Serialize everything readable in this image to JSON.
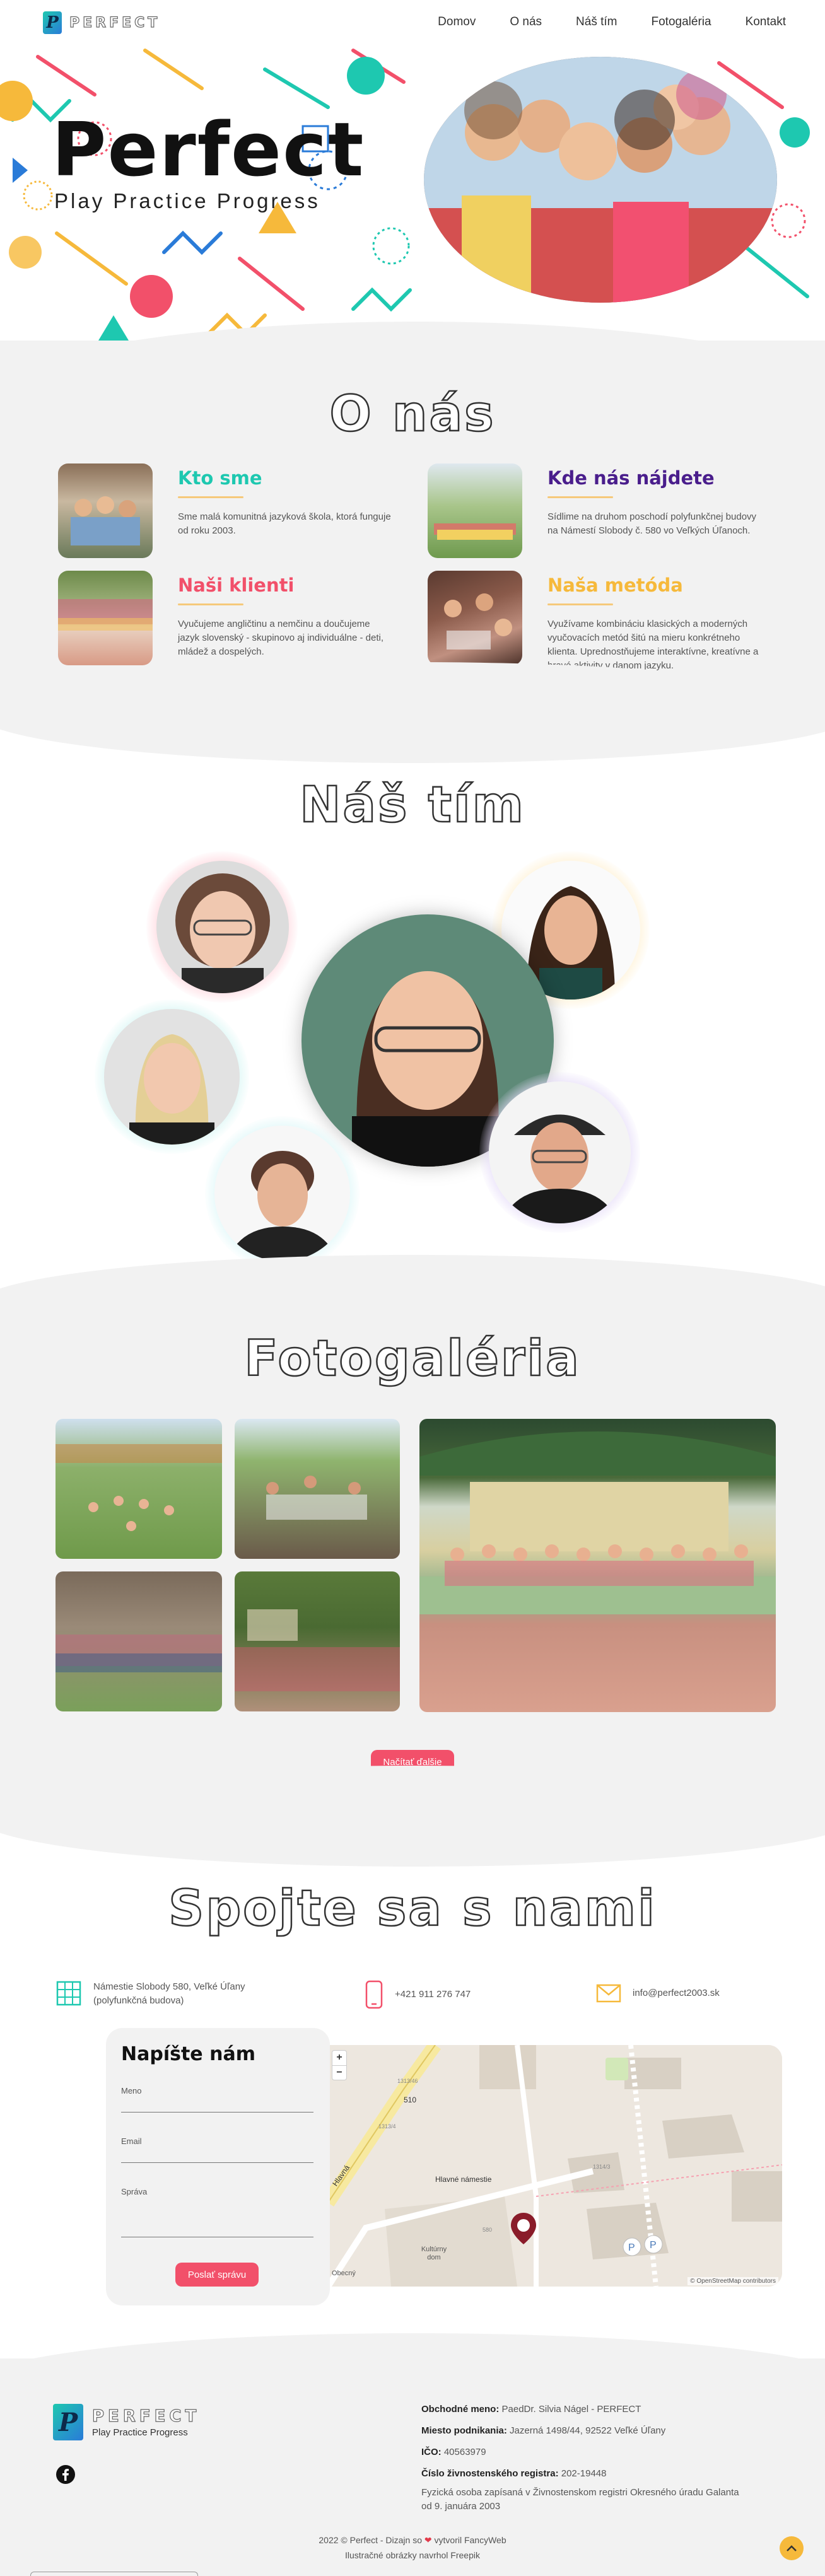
{
  "header": {
    "logo_letter": "P",
    "logo_text": "PERFECT",
    "nav": [
      "Domov",
      "O nás",
      "Náš tím",
      "Fotogaléria",
      "Kontakt"
    ]
  },
  "hero": {
    "title": "Perfect",
    "subtitle": "Play Practice Progress"
  },
  "about": {
    "title": "O nás",
    "cards": [
      {
        "heading": "Kto sme",
        "color": "#1ec8b0",
        "text": "Sme malá komunitná jazyková škola, ktorá funguje od roku 2003."
      },
      {
        "heading": "Kde nás nájdete",
        "color": "#4a1e8c",
        "text": "Sídlime na druhom poschodí polyfunkčnej budovy na Námestí Slobody č. 580 vo Veľkých Úľanoch."
      },
      {
        "heading": "Naši klienti",
        "color": "#f2506a",
        "text": "Vyučujeme angličtinu a nemčinu a doučujeme jazyk slovenský - skupinovo aj individuálne - deti, mládež a dospelých."
      },
      {
        "heading": "Naša metóda",
        "color": "#f6b93b",
        "text": "Využívame kombináciu klasických a moderných vyučovacích metód šitú na mieru konkrétneho klienta. Uprednostňujeme interaktívne, kreatívne a hravé aktivity v danom jazyku."
      }
    ]
  },
  "team": {
    "title": "Náš tím"
  },
  "gallery": {
    "title": "Fotogaléria",
    "load_more": "Načítať ďalšie"
  },
  "contact": {
    "title": "Spojte sa s nami",
    "address_line1": "Námestie Slobody 580, Veľké Úľany",
    "address_line2": "(polyfunkčná budova)",
    "phone": "+421 911 276 747",
    "email": "info@perfect2003.sk",
    "form": {
      "title": "Napíšte nám",
      "name_label": "Meno",
      "email_label": "Email",
      "message_label": "Správa",
      "submit": "Poslať správu"
    },
    "map": {
      "zoom_in": "+",
      "zoom_out": "−",
      "square_label": "Hlavné námestie",
      "street_label": "Hlavná",
      "road_number": "510",
      "attribution": "© OpenStreetMap contributors",
      "house_numbers": [
        "1313/46",
        "1313/4",
        "1314/3",
        "580"
      ],
      "places": [
        "Obecný",
        "Kultúrny dom"
      ]
    }
  },
  "footer": {
    "logo_letter": "P",
    "logo_text": "PERFECT",
    "tagline": "Play Practice Progress",
    "business_name_label": "Obchodné meno:",
    "business_name": "PaedDr. Silvia Nágel - PERFECT",
    "place_label": "Miesto podnikania:",
    "place": "Jazerná 1498/44, 92522 Veľké Úľany",
    "ico_label": "IČO:",
    "ico": "40563979",
    "register_label": "Číslo živnostenského registra:",
    "register": "202-19448",
    "note": "Fyzická osoba zapísaná v Živnostenskom registri Okresného úradu Galanta od 9. januára 2003",
    "copyright_a": "2022 © Perfect - Dizajn so",
    "copyright_b": "vytvoril FancyWeb",
    "illustrations": "Ilustračné obrázky navrhol Freepik"
  }
}
